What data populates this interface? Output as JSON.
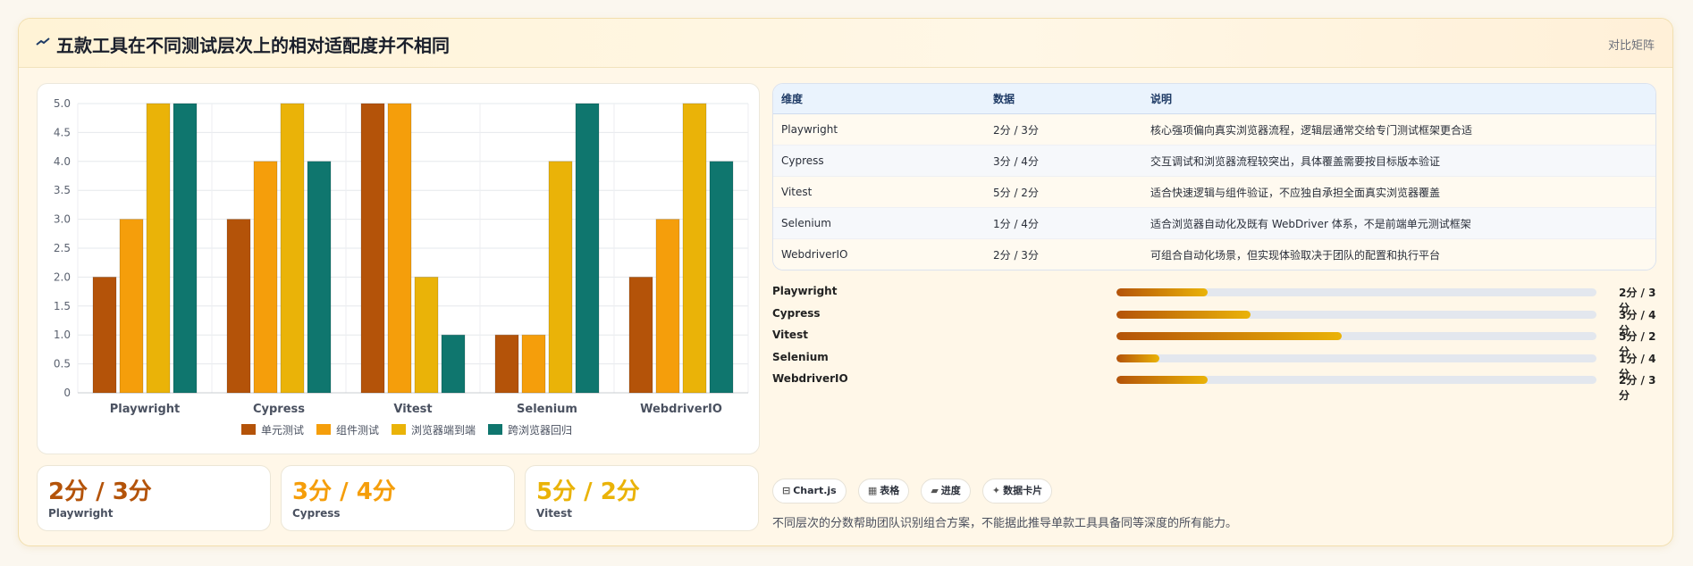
{
  "header": {
    "title": "五款工具在不同测试层次上的相对适配度并不相同",
    "right_label": "对比矩阵"
  },
  "chart_data": {
    "type": "bar",
    "categories": [
      "Playwright",
      "Cypress",
      "Vitest",
      "Selenium",
      "WebdriverIO"
    ],
    "series": [
      {
        "name": "单元测试",
        "color": "#b45309",
        "values": [
          2,
          3,
          5,
          1,
          2
        ]
      },
      {
        "name": "组件测试",
        "color": "#f59e0b",
        "values": [
          3,
          4,
          5,
          1,
          3
        ]
      },
      {
        "name": "浏览器端到端",
        "color": "#eab308",
        "values": [
          5,
          5,
          2,
          4,
          5
        ]
      },
      {
        "name": "跨浏览器回归",
        "color": "#0f766e",
        "values": [
          5,
          4,
          1,
          5,
          4
        ]
      }
    ],
    "ylim": [
      0,
      5
    ],
    "yticks": [
      "0",
      "0.5",
      "1.0",
      "1.5",
      "2.0",
      "2.5",
      "3.0",
      "3.5",
      "4.0",
      "4.5",
      "5.0"
    ],
    "legend_position": "bottom",
    "grid": true
  },
  "table": {
    "headers": [
      "维度",
      "数据",
      "说明"
    ],
    "rows": [
      [
        "Playwright",
        "2分 / 3分",
        "核心强项偏向真实浏览器流程，逻辑层通常交给专门测试框架更合适"
      ],
      [
        "Cypress",
        "3分 / 4分",
        "交互调试和浏览器流程较突出，具体覆盖需要按目标版本验证"
      ],
      [
        "Vitest",
        "5分 / 2分",
        "适合快速逻辑与组件验证，不应独自承担全面真实浏览器覆盖"
      ],
      [
        "Selenium",
        "1分 / 4分",
        "适合浏览器自动化及既有 WebDriver 体系，不是前端单元测试框架"
      ],
      [
        "WebdriverIO",
        "2分 / 3分",
        "可组合自动化场景，但实现体验取决于团队的配置和执行平台"
      ]
    ]
  },
  "progress": [
    {
      "label": "Playwright",
      "value": "2分 / 3分",
      "fraction": 0.19
    },
    {
      "label": "Cypress",
      "value": "3分 / 4分",
      "fraction": 0.28
    },
    {
      "label": "Vitest",
      "value": "5分 / 2分",
      "fraction": 0.47
    },
    {
      "label": "Selenium",
      "value": "1分 / 4分",
      "fraction": 0.09
    },
    {
      "label": "WebdriverIO",
      "value": "2分 / 3分",
      "fraction": 0.19
    }
  ],
  "stats": [
    {
      "big": "2分 / 3分",
      "small": "Playwright",
      "color": "#b45309"
    },
    {
      "big": "3分 / 4分",
      "small": "Cypress",
      "color": "#f59e0b"
    },
    {
      "big": "5分 / 2分",
      "small": "Vitest",
      "color": "#eab308"
    }
  ],
  "chips": [
    {
      "icon": "⊟",
      "label": "Chart.js"
    },
    {
      "icon": "▦",
      "label": "表格"
    },
    {
      "icon": "▰",
      "label": "进度"
    },
    {
      "icon": "✦",
      "label": "数据卡片"
    }
  ],
  "footnote": "不同层次的分数帮助团队识别组合方案，不能据此推导单款工具具备同等深度的所有能力。"
}
